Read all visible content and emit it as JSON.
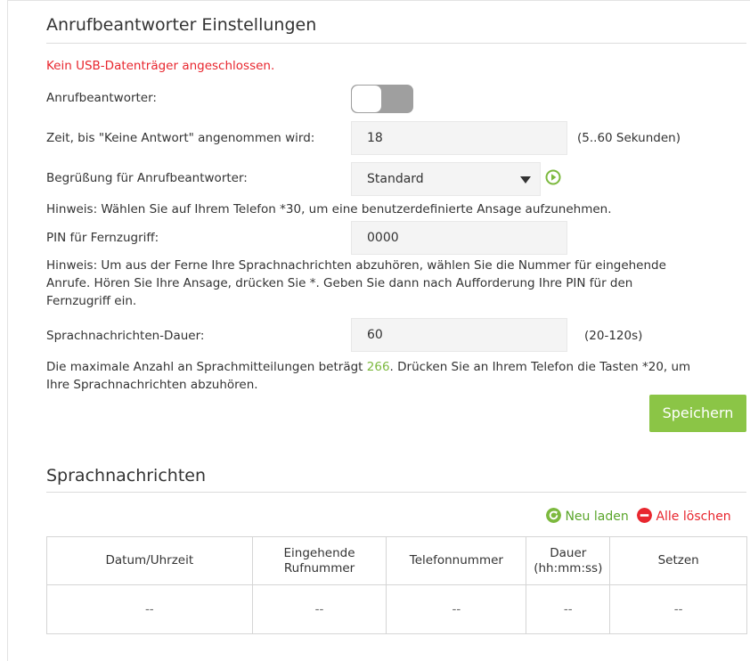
{
  "settings": {
    "title": "Anrufbeantworter Einstellungen",
    "error": "Kein USB-Datenträger angeschlossen.",
    "answering_machine_label": "Anrufbeantworter:",
    "answering_machine_enabled": false,
    "timeout_label": "Zeit, bis \"Keine Antwort\" angenommen wird:",
    "timeout_value": "18",
    "timeout_unit": "(5..60 Sekunden)",
    "greeting_label": "Begrüßung für Anrufbeantworter:",
    "greeting_value": "Standard",
    "hint_greeting": "Hinweis: Wählen Sie auf Ihrem Telefon *30, um eine benutzerdefinierte Ansage aufzunehmen.",
    "pin_label": "PIN für Fernzugriff:",
    "pin_value": "0000",
    "hint_remote_1": "Hinweis: Um aus der Ferne Ihre Sprachnachrichten abzuhören, wählen Sie die Nummer für eingehende",
    "hint_remote_2": "Anrufe. Hören Sie Ihre Ansage, drücken Sie *. Geben Sie dann nach Aufforderung Ihre PIN für den",
    "hint_remote_3": "Fernzugriff ein.",
    "duration_label": "Sprachnachrichten-Dauer:",
    "duration_value": "60",
    "duration_unit": "(20-120s)",
    "max_msg_prefix": "Die maximale Anzahl an Sprachmitteilungen beträgt ",
    "max_msg_count": "266",
    "max_msg_suffix": ". Drücken Sie an Ihrem Telefon die Tasten *20, um",
    "max_msg_line2": "Ihre Sprachnachrichten abzuhören.",
    "save_label": "Speichern"
  },
  "messages": {
    "title": "Sprachnachrichten",
    "reload_label": "Neu laden",
    "delete_all_label": "Alle löschen",
    "columns": [
      "Datum/Uhrzeit",
      "Eingehende Rufnummer",
      "Telefonnummer",
      "Dauer (hh:mm:ss)",
      "Setzen"
    ],
    "columns_line1": [
      "Datum/Uhrzeit",
      "Eingehende",
      "Telefonnummer",
      "Dauer",
      "Setzen"
    ],
    "columns_line2": [
      "",
      "Rufnummer",
      "",
      "(hh:mm:ss)",
      ""
    ],
    "row": [
      "--",
      "--",
      "--",
      "--",
      "--"
    ]
  },
  "colors": {
    "accent_green": "#8bc546",
    "error_red": "#e8262e"
  }
}
